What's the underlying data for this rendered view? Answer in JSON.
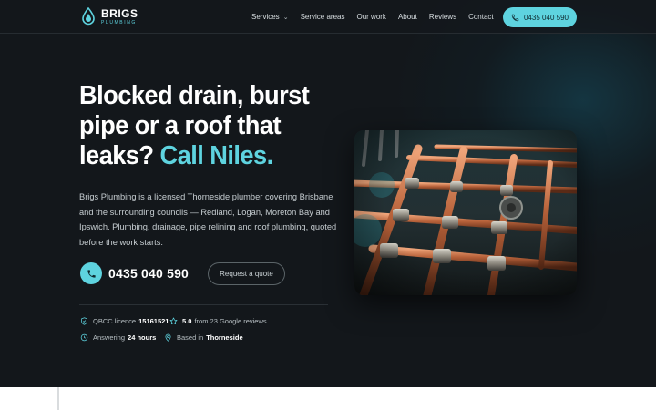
{
  "brand": {
    "name": "BRIGS",
    "tagline": "PLUMBING",
    "accent": "#5ed3df",
    "background": "#13171b"
  },
  "nav": {
    "items": [
      {
        "label": "Services",
        "has_dropdown": true
      },
      {
        "label": "Service areas"
      },
      {
        "label": "Our work"
      },
      {
        "label": "About"
      },
      {
        "label": "Reviews"
      },
      {
        "label": "Contact"
      }
    ],
    "phone_label": "0435 040 590",
    "phone_icon": "phone-icon"
  },
  "hero": {
    "headline_main": "Blocked drain, burst pipe or a roof that leaks?",
    "headline_accent": "Call Niles.",
    "description": "Brigs Plumbing is a licensed Thorneside plumber covering Brisbane and the surrounding councils — Redland, Logan, Moreton Bay and Ipswich. Plumbing, drainage, pipe relining and roof plumbing, quoted before the work starts.",
    "call_number": "0435 040 590",
    "quote_label": "Request a quote",
    "trust": [
      {
        "icon": "shield-icon",
        "prefix": "QBCC licence",
        "value": "15161521",
        "suffix": ""
      },
      {
        "icon": "star-icon",
        "prefix": "",
        "value": "5.0",
        "suffix": "from 23 Google reviews"
      },
      {
        "icon": "clock-icon",
        "prefix": "Answering",
        "value": "24 hours",
        "suffix": ""
      },
      {
        "icon": "map-pin-icon",
        "prefix": "Based in",
        "value": "Thorneside",
        "suffix": ""
      }
    ],
    "image_subject": "copper pipes"
  }
}
